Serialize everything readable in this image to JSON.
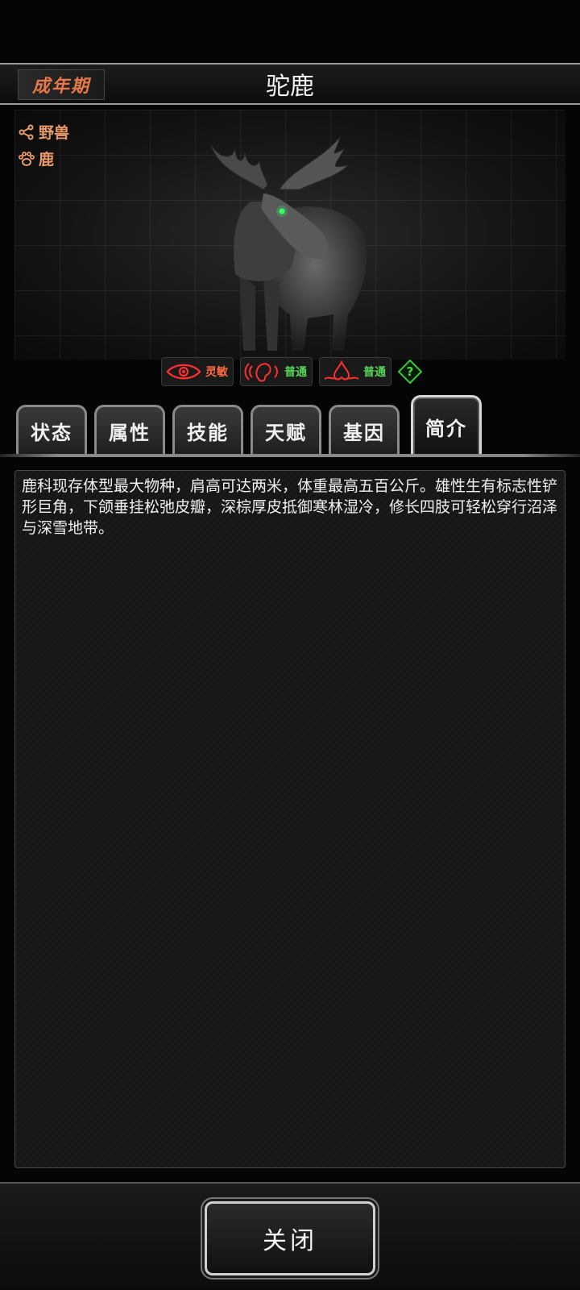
{
  "header": {
    "stage": "成年期",
    "title": "驼鹿"
  },
  "categories": [
    {
      "icon": "share-icon",
      "label": "野兽"
    },
    {
      "icon": "paw-icon",
      "label": "鹿"
    }
  ],
  "senses": [
    {
      "icon": "eye-icon",
      "label": "灵敏",
      "color": "#ff5a4a"
    },
    {
      "icon": "ear-icon",
      "label": "普通",
      "color": "#58d458"
    },
    {
      "icon": "nose-icon",
      "label": "普通",
      "color": "#58d458"
    }
  ],
  "help_icon": "question-diamond-icon",
  "tabs": [
    {
      "label": "状态"
    },
    {
      "label": "属性"
    },
    {
      "label": "技能"
    },
    {
      "label": "天赋"
    },
    {
      "label": "基因"
    },
    {
      "label": "简介",
      "active": true
    }
  ],
  "description": "鹿科现存体型最大物种，肩高可达两米，体重最高五百公斤。雄性生有标志性铲形巨角，下颌垂挂松弛皮瓣，深棕厚皮抵御寒林湿冷，修长四肢可轻松穿行沼泽与深雪地带。",
  "footer": {
    "close_label": "关闭"
  },
  "colors": {
    "accent": "#e8774a",
    "sense_alert": "#ff3030",
    "sense_normal": "#44cc44"
  }
}
